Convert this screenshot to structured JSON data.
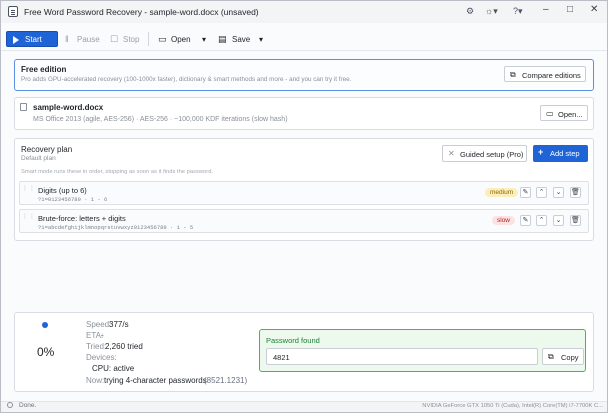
{
  "window": {
    "title": "Free Word Password Recovery - sample-word.docx (unsaved)",
    "controls": [
      "–",
      "□",
      "✕"
    ]
  },
  "toolbar": {
    "start": "Start",
    "pause": "Pause",
    "stop": "Stop",
    "open": "Open",
    "save": "Save"
  },
  "edition": {
    "title": "Free edition",
    "description": "Pro adds GPU-accelerated recovery (100-1000x faster), dictionary & smart methods and more - and you can try it free.",
    "compare": "Compare editions"
  },
  "file": {
    "name": "sample-word.docx",
    "details": "MS Office 2013 (agile, AES-256) · AES-256 · ~100,000 KDF iterations (slow hash)",
    "open": "Open..."
  },
  "plan": {
    "title": "Recovery plan",
    "subtitle": "Default plan",
    "hint": "Smart mode runs these in order, stopping as soon as it finds the password.",
    "guided": "Guided setup (Pro)",
    "add_step": "Add step",
    "steps": [
      {
        "name": "Digits (up to 6)",
        "charset": "?1=0123456789 · 1 - 6",
        "badge": "medium",
        "badge_color": "#f2c230"
      },
      {
        "name": "Brute-force: letters + digits",
        "charset": "?1=abcdefghijklmnopqrstuvwxyz0123456789 · 1 - 5",
        "badge": "slow",
        "badge_color": "#e5484d"
      }
    ]
  },
  "progress": {
    "percent": "0%",
    "speed_label": "Speed:",
    "speed": "377/s",
    "eta_label": "ETA:",
    "eta": "-",
    "tried_label": "Tried:",
    "tried": "2,260 tried",
    "devices_label": "Devices:",
    "device": "CPU: active",
    "now_label": "Now:",
    "now": "trying 4-character passwords",
    "now_count": "(8521.1231)"
  },
  "found": {
    "title": "Password found",
    "password": "4821",
    "copy": "Copy"
  },
  "statusbar": {
    "left": "Done.",
    "right": "NVIDIA GeForce GTX 1050 Ti (Cuda), Intel(R) Core(TM) i7-7700K C..."
  },
  "colors": {
    "accent": "#1f64d6",
    "found_border": "#3fb950",
    "found_bg": "#eef9ee"
  }
}
